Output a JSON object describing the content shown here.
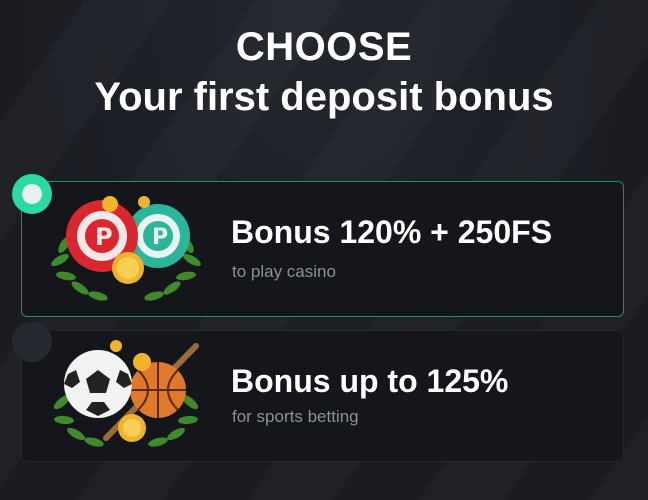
{
  "heading": {
    "line1": "CHOOSE",
    "line2": "Your first deposit bonus"
  },
  "options": [
    {
      "title": "Bonus 120% + 250FS",
      "subtitle": "to play casino",
      "selected": true,
      "icon": "casino-chips-icon"
    },
    {
      "title": "Bonus up to 125%",
      "subtitle": "for sports betting",
      "selected": false,
      "icon": "sports-balls-icon"
    }
  ],
  "colors": {
    "background": "#1d2027",
    "card": "#14161b",
    "accent": "#2bd9a4",
    "subtitle": "#8a8f99"
  }
}
